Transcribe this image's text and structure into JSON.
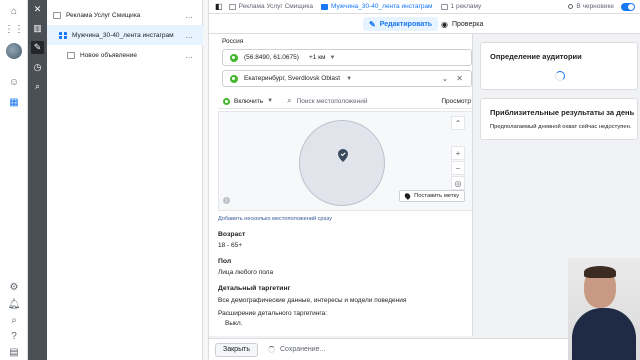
{
  "tree": {
    "campaign": "Реклама Услуг Смищика",
    "adset": "Мужчина_30-40_лента инстаграм",
    "ad": "Новое объявление",
    "more": "…"
  },
  "topbar": {
    "campaign": "Реклама Услуг Смищика",
    "adset": "Мужчина_30-40_лента инстаграм",
    "ads": "1 рекламу",
    "status": "В черновике"
  },
  "modes": {
    "edit": "Редактировать",
    "review": "Проверка"
  },
  "location": {
    "region_label": "Россия",
    "coords": "(56.8490, 61.0675)",
    "radius": "+1 км",
    "city": "Екатеринбург, Sverdlovsk Oblast",
    "include": "Включить",
    "search_placeholder": "Поиск местоположений",
    "browse": "Просмотр",
    "place_pin": "Поставить метку",
    "add_multiple": "Добавить несколько местоположений сразу"
  },
  "targeting": {
    "age_h": "Возраст",
    "age_v": "18 - 65+",
    "gender_h": "Пол",
    "gender_v": "Лица любого пола",
    "detailed_h": "Детальный таргетинг",
    "detailed_v": "Все демографические данные, интересы и модели поведения",
    "expansion_h": "Расширение детального таргетинга:",
    "expansion_v": "Выкл."
  },
  "panels": {
    "audience_h": "Определение аудитории",
    "results_h": "Приблизительные результаты за день",
    "results_t": "Предполагаемый дневной охват сейчас недоступен."
  },
  "bottom": {
    "close": "Закрыть",
    "saving": "Сохранение..."
  },
  "colors": {
    "accent": "#1877f2",
    "pin": "#42b72a",
    "toolcol": "#4b4f56"
  },
  "icons": [
    "home-icon",
    "apps-icon",
    "chart-icon",
    "emoji-icon",
    "table-icon",
    "gear-icon",
    "bell-icon",
    "search-icon",
    "help-icon",
    "bug-icon",
    "close-icon",
    "pencil-icon",
    "clock-icon",
    "zoom-icon",
    "sidebar-toggle-icon"
  ]
}
